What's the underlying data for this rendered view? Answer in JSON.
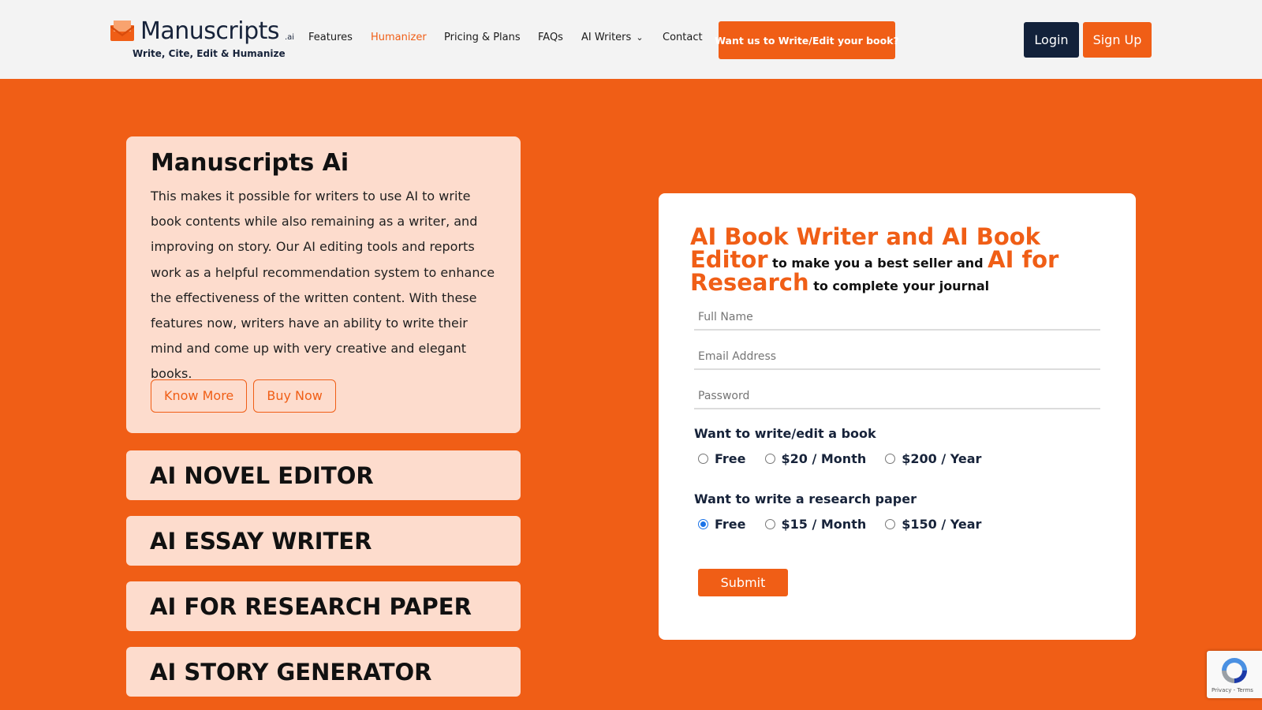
{
  "header": {
    "logo": {
      "name": "Manuscripts",
      "suffix": ".ai",
      "tagline": "Write, Cite, Edit & Humanize"
    },
    "nav": [
      {
        "label": "Features",
        "active": false
      },
      {
        "label": "Humanizer",
        "active": true
      },
      {
        "label": "Pricing & Plans",
        "active": false
      },
      {
        "label": "FAQs",
        "active": false
      },
      {
        "label": "AI Writers",
        "active": false
      },
      {
        "label": "Contact",
        "active": false
      }
    ],
    "cta_label": "Want us to Write/Edit your book?",
    "login_label": "Login",
    "signup_label": "Sign Up"
  },
  "info_card": {
    "title": "Manuscripts Ai",
    "description": "This makes it possible for writers to use AI to write book contents while also remaining as a writer, and improving on story. Our AI editing tools and reports work as a helpful recommendation system to enhance the effectiveness of the written content. With these features now, writers have an ability to write their mind and come up with very creative and elegant books.",
    "know_more_label": "Know More",
    "buy_now_label": "Buy Now"
  },
  "tools": [
    "AI NOVEL EDITOR",
    "AI ESSAY WRITER",
    "AI FOR RESEARCH PAPER",
    "AI STORY GENERATOR"
  ],
  "form": {
    "heading": {
      "part1": "AI Book Writer and AI Book Editor",
      "part2": " to make you a best seller and ",
      "part3": "AI for Research",
      "part4": " to complete your journal"
    },
    "full_name_placeholder": "Full Name",
    "email_placeholder": "Email Address",
    "password_placeholder": "Password",
    "book_group": {
      "label": "Want to write/edit a book",
      "options": [
        "Free",
        "$20 / Month",
        "$200 / Year"
      ],
      "selected": ""
    },
    "research_group": {
      "label": "Want to write a research paper",
      "options": [
        "Free",
        "$15 / Month",
        "$150 / Year"
      ],
      "selected": "Free"
    },
    "submit_label": "Submit"
  },
  "recaptcha": {
    "text": "Privacy - Terms"
  },
  "colors": {
    "accent": "#f05e16",
    "navy": "#12213a",
    "card": "#fddccd"
  }
}
